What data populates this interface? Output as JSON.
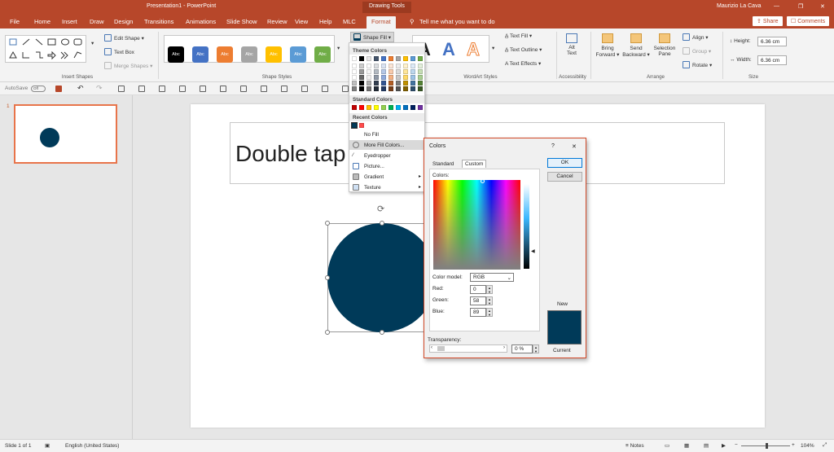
{
  "window": {
    "title": "Presentation1 - PowerPoint",
    "context": "Drawing Tools",
    "user": "Maurizio La Cava"
  },
  "tabs": [
    "File",
    "Home",
    "Insert",
    "Draw",
    "Design",
    "Transitions",
    "Animations",
    "Slide Show",
    "Review",
    "View",
    "Help",
    "MLC",
    "Format"
  ],
  "tell_me": "Tell me what you want to do",
  "share_label": "Share",
  "comments_label": "Comments",
  "ribbon": {
    "insert_shapes": {
      "label": "Insert Shapes",
      "edit_shape": "Edit Shape",
      "text_box": "Text Box",
      "merge_shapes": "Merge Shapes"
    },
    "shape_styles": {
      "label": "Shape Styles",
      "preset_text": "Abc",
      "colors": [
        "#000000",
        "#4472c4",
        "#ed7d31",
        "#a5a5a5",
        "#ffc000",
        "#5b9bd5",
        "#70ad47"
      ],
      "shape_fill": "Shape Fill"
    },
    "wordart": {
      "label": "WordArt Styles",
      "letter": "A",
      "text_fill": "Text Fill",
      "text_outline": "Text Outline",
      "text_effects": "Text Effects"
    },
    "accessibility": {
      "label": "Accessibility",
      "alt_text_1": "Alt",
      "alt_text_2": "Text"
    },
    "arrange": {
      "label": "Arrange",
      "bring_forward_1": "Bring",
      "bring_forward_2": "Forward",
      "send_backward_1": "Send",
      "send_backward_2": "Backward",
      "selection_pane_1": "Selection",
      "selection_pane_2": "Pane",
      "align": "Align",
      "group": "Group",
      "rotate": "Rotate"
    },
    "size": {
      "label": "Size",
      "height_label": "Height:",
      "height_value": "6.36 cm",
      "width_label": "Width:",
      "width_value": "6.36 cm"
    }
  },
  "qat": {
    "autosave": "AutoSave",
    "toggle_state": "Off"
  },
  "thumbnail": {
    "number": "1"
  },
  "slide": {
    "title_text": "Double tap",
    "shape_color": "#003a59"
  },
  "shape_fill_menu": {
    "theme_colors_label": "Theme Colors",
    "theme_top": [
      "#ffffff",
      "#000000",
      "#e7e6e6",
      "#44546a",
      "#4472c4",
      "#ed7d31",
      "#a5a5a5",
      "#ffc000",
      "#5b9bd5",
      "#70ad47"
    ],
    "standard_colors_label": "Standard Colors",
    "standard": [
      "#c00000",
      "#ff0000",
      "#ffc000",
      "#ffff00",
      "#92d050",
      "#00b050",
      "#00b0f0",
      "#0070c0",
      "#002060",
      "#7030a0"
    ],
    "recent_colors_label": "Recent Colors",
    "recent": [
      "#003a59",
      "#ff4b4b"
    ],
    "no_fill": "No Fill",
    "more_fill": "More Fill Colors...",
    "eyedropper": "Eyedropper",
    "picture": "Picture...",
    "gradient": "Gradient",
    "texture": "Texture"
  },
  "colors_dialog": {
    "title": "Colors",
    "help": "?",
    "close": "✕",
    "tab_standard": "Standard",
    "tab_custom": "Custom",
    "colors_label": "Colors:",
    "ok": "OK",
    "cancel": "Cancel",
    "model_label": "Color model:",
    "model_value": "RGB",
    "red_label": "Red:",
    "red": "0",
    "green_label": "Green:",
    "green": "58",
    "blue_label": "Blue:",
    "blue": "89",
    "transparency_label": "Transparency:",
    "transparency_value": "0 %",
    "new_label": "New",
    "current_label": "Current",
    "new_color": "#003a59"
  },
  "status": {
    "slide": "Slide 1 of 1",
    "language": "English (United States)",
    "notes": "Notes",
    "zoom": "104%"
  }
}
